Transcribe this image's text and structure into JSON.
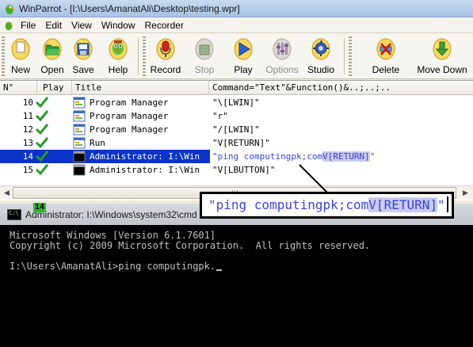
{
  "window": {
    "title": "WinParrot - [I:\\Users\\AmanatAli\\Desktop\\testing.wpr]"
  },
  "menu": [
    "File",
    "Edit",
    "View",
    "Window",
    "Recorder"
  ],
  "toolbar": [
    {
      "label": "New",
      "icon": "new-icon",
      "enabled": true
    },
    {
      "label": "Open",
      "icon": "open-icon",
      "enabled": true
    },
    {
      "label": "Save",
      "icon": "save-icon",
      "enabled": true
    },
    {
      "label": "Help",
      "icon": "help-parrot-icon",
      "enabled": true
    },
    {
      "label": "Record",
      "icon": "record-microphone-icon",
      "enabled": true
    },
    {
      "label": "Stop",
      "icon": "stop-icon",
      "enabled": false
    },
    {
      "label": "Play",
      "icon": "play-icon",
      "enabled": true
    },
    {
      "label": "Options",
      "icon": "options-icon",
      "enabled": false
    },
    {
      "label": "Studio",
      "icon": "studio-icon",
      "enabled": true
    },
    {
      "label": "Delete",
      "icon": "delete-icon",
      "enabled": true
    },
    {
      "label": "Move Down",
      "icon": "move-down-icon",
      "enabled": true
    }
  ],
  "list": {
    "columns": [
      "N°",
      "Play",
      "Title",
      "Command=\"Text\"&Function()&..;..;.."
    ],
    "rows": [
      {
        "num": "10",
        "title": "Program Manager",
        "command": "\"\\[LWIN]\"",
        "icon": "window-icon",
        "selected": false
      },
      {
        "num": "11",
        "title": "Program Manager",
        "command": "\"r\"",
        "icon": "window-icon",
        "selected": false
      },
      {
        "num": "12",
        "title": "Program Manager",
        "command": "\"/[LWIN]\"",
        "icon": "window-icon",
        "selected": false
      },
      {
        "num": "13",
        "title": "Run",
        "command": "\"V[RETURN]\"",
        "icon": "window-icon",
        "selected": false
      },
      {
        "num": "14",
        "title": "Administrator: I:\\Win",
        "command_pre": "\"ping computingpk;com",
        "command_hl": "V[RETURN]",
        "command_post": "\"",
        "icon": "console-icon",
        "selected": true
      },
      {
        "num": "15",
        "title": "Administrator: I:\\Win",
        "command": "\"V[LBUTTON]\"",
        "icon": "console-icon",
        "selected": false
      }
    ]
  },
  "callout": {
    "pre": "\"ping computingpk;com",
    "hl": "V[RETURN]",
    "post": "\""
  },
  "console": {
    "title": "Administrator: I:\\Windows\\system32\\cmd",
    "badge": "14",
    "icon_text": "C:\\",
    "lines": [
      "Microsoft Windows [Version 6.1.7601]",
      "Copyright (c) 2009 Microsoft Corporation.  All rights reserved.",
      "",
      "I:\\Users\\AmanatAli>ping computingpk."
    ]
  }
}
